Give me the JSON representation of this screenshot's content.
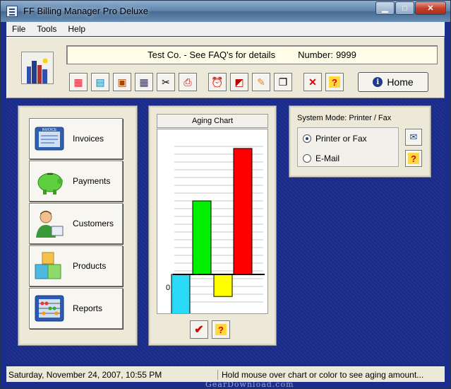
{
  "window": {
    "title": "FF Billing Manager Pro Deluxe"
  },
  "menu": {
    "items": [
      "File",
      "Tools",
      "Help"
    ]
  },
  "company": {
    "text": "Test Co. - See FAQ's for details",
    "number_label": "Number:",
    "number_value": "9999"
  },
  "toolbar": {
    "icons": [
      "spreadsheet-icon",
      "calculator-icon",
      "briefcase-icon",
      "calendar-icon",
      "tools-icon",
      "pdf-icon",
      "alarm-clock-icon",
      "eraser-icon",
      "paint-icon",
      "copy-documents-icon",
      "close-icon",
      "help-icon"
    ],
    "home_label": "Home"
  },
  "nav": {
    "invoices": "Invoices",
    "invoice_icon_text": "INVOICE",
    "payments": "Payments",
    "customers": "Customers",
    "products": "Products",
    "reports": "Reports"
  },
  "chart_data": {
    "type": "bar",
    "title": "Aging Chart",
    "zero_label": "0",
    "grid": true,
    "categories": [
      "",
      "",
      "",
      ""
    ],
    "values": [
      -0.5,
      0.8,
      -0.24,
      1.37
    ],
    "colors": [
      "#29d9f5",
      "#00f000",
      "#ffff00",
      "#ff0000"
    ],
    "ylim": [
      -0.6,
      1.4
    ]
  },
  "mode": {
    "title": "System Mode: Printer / Fax",
    "printer_label": "Printer or Fax",
    "email_label": "E-Mail",
    "selected": "printer"
  },
  "status": {
    "datetime": "Saturday, November 24, 2007, 10:55 PM",
    "hint": "Hold mouse over chart or color to see aging amount..."
  },
  "watermark": "GearDownload.com"
}
